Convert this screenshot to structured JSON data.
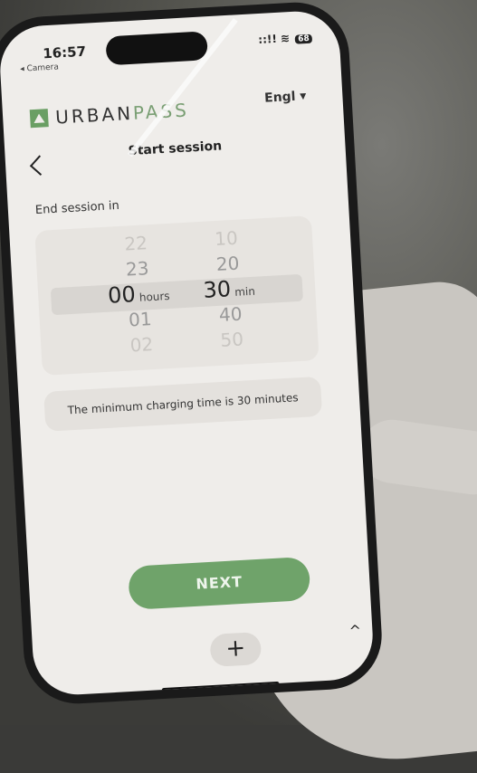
{
  "status_bar": {
    "time": "16:57",
    "back_app": "◂ Camera",
    "signal": "::!! ≋",
    "battery": "68"
  },
  "header": {
    "brand_bold": "URBAN",
    "brand_light": "PASS",
    "language": "Engl  ▾"
  },
  "page": {
    "title": "Start session",
    "label": "End session in"
  },
  "picker": {
    "hours": [
      "22",
      "23",
      "00",
      "01",
      "02"
    ],
    "hours_selected_index": 2,
    "hours_unit": "hours",
    "minutes": [
      "10",
      "20",
      "30",
      "40",
      "50"
    ],
    "minutes_selected_index": 2,
    "minutes_unit": "min"
  },
  "info": {
    "text": "The minimum charging time is 30 minutes"
  },
  "actions": {
    "next_label": "NEXT",
    "plus_label": "+",
    "up_label": "^"
  },
  "colors": {
    "accent": "#6fa36a",
    "screen_bg": "#efedea"
  }
}
